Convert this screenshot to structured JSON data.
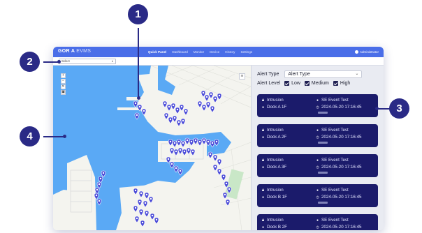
{
  "app": {
    "logo": "GOR",
    "logo_mark": "A",
    "logo_suffix": "EVMS",
    "nav": [
      "Quick Panel",
      "Dashboard",
      "Monitor",
      "Device",
      "History",
      "Settings"
    ],
    "active_nav": "Quick Panel",
    "user": "Administrator",
    "site_select": "Select"
  },
  "map": {
    "controls": [
      "+",
      "−",
      "✕",
      "▣"
    ],
    "layer_icon": "layers-icon",
    "marker_color": "#4b4bd8",
    "water_color": "#5aa9f5"
  },
  "filters": {
    "type_label": "Alert Type",
    "type_value": "Alert Type",
    "level_label": "Alert Level",
    "levels": [
      "Low",
      "Medium",
      "High"
    ]
  },
  "alerts": [
    {
      "type": "Intrusion",
      "location": "Dock A 1F",
      "event": "SE Event Test",
      "time": "2024-05-20 17:16:45"
    },
    {
      "type": "Intrusion",
      "location": "Dock A 2F",
      "event": "SE Event Test",
      "time": "2024-05-20 17:16:45"
    },
    {
      "type": "Intrusion",
      "location": "Dock A 3F",
      "event": "SE Event Test",
      "time": "2024-05-20 17:16:45"
    },
    {
      "type": "Intrusion",
      "location": "Dock B 1F",
      "event": "SE Event Test",
      "time": "2024-05-20 17:16:45"
    },
    {
      "type": "Intrusion",
      "location": "Dock B 2F",
      "event": "SE Event Test",
      "time": "2024-05-20 17:16:45"
    }
  ],
  "callouts": [
    "1",
    "2",
    "3",
    "4"
  ],
  "colors": {
    "brand": "#4a6ee8",
    "card": "#1b1b6b",
    "callout": "#2a2a86"
  }
}
